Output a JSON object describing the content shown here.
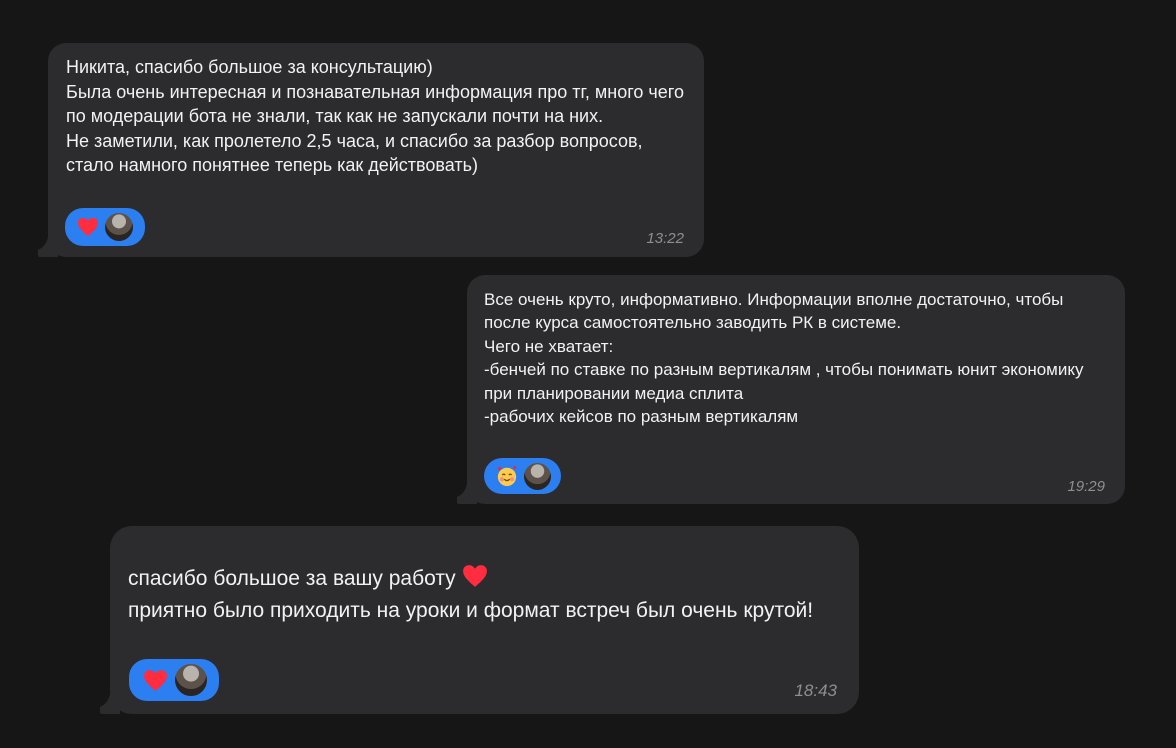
{
  "messages": [
    {
      "text": "Никита, спасибо большое за консультацию)\nБыла очень интересная и познавательная информация про тг, много чего по модерации бота не знали, так как не запускали почти на них.\nНе заметили, как пролетело 2,5 часа, и спасибо за разбор вопросов, стало намного понятнее теперь как действовать)",
      "time": "13:22",
      "reaction": "heart-icon"
    },
    {
      "text": "Все очень круто, информативно. Информации вполне достаточно, чтобы после курса самостоятельно заводить РК в системе.\nЧего не хватает:\n-бенчей по ставке по разным вертикалям , чтобы понимать юнит экономику при планировании медиа сплита\n-рабочих кейсов по разным вертикалям",
      "time": "19:29",
      "reaction": "smiling-face-with-hearts-icon"
    },
    {
      "text": "спасибо большое за вашу работу",
      "text_rest": "приятно было приходить на уроки и формат встреч был очень крутой!",
      "time": "18:43",
      "reaction": "heart-icon"
    }
  ],
  "colors": {
    "background": "#161616",
    "bubble": "#2c2c2e",
    "reaction_pill": "#2b7ff0",
    "time": "#8e8e93",
    "heart": "#ff2d3f"
  }
}
